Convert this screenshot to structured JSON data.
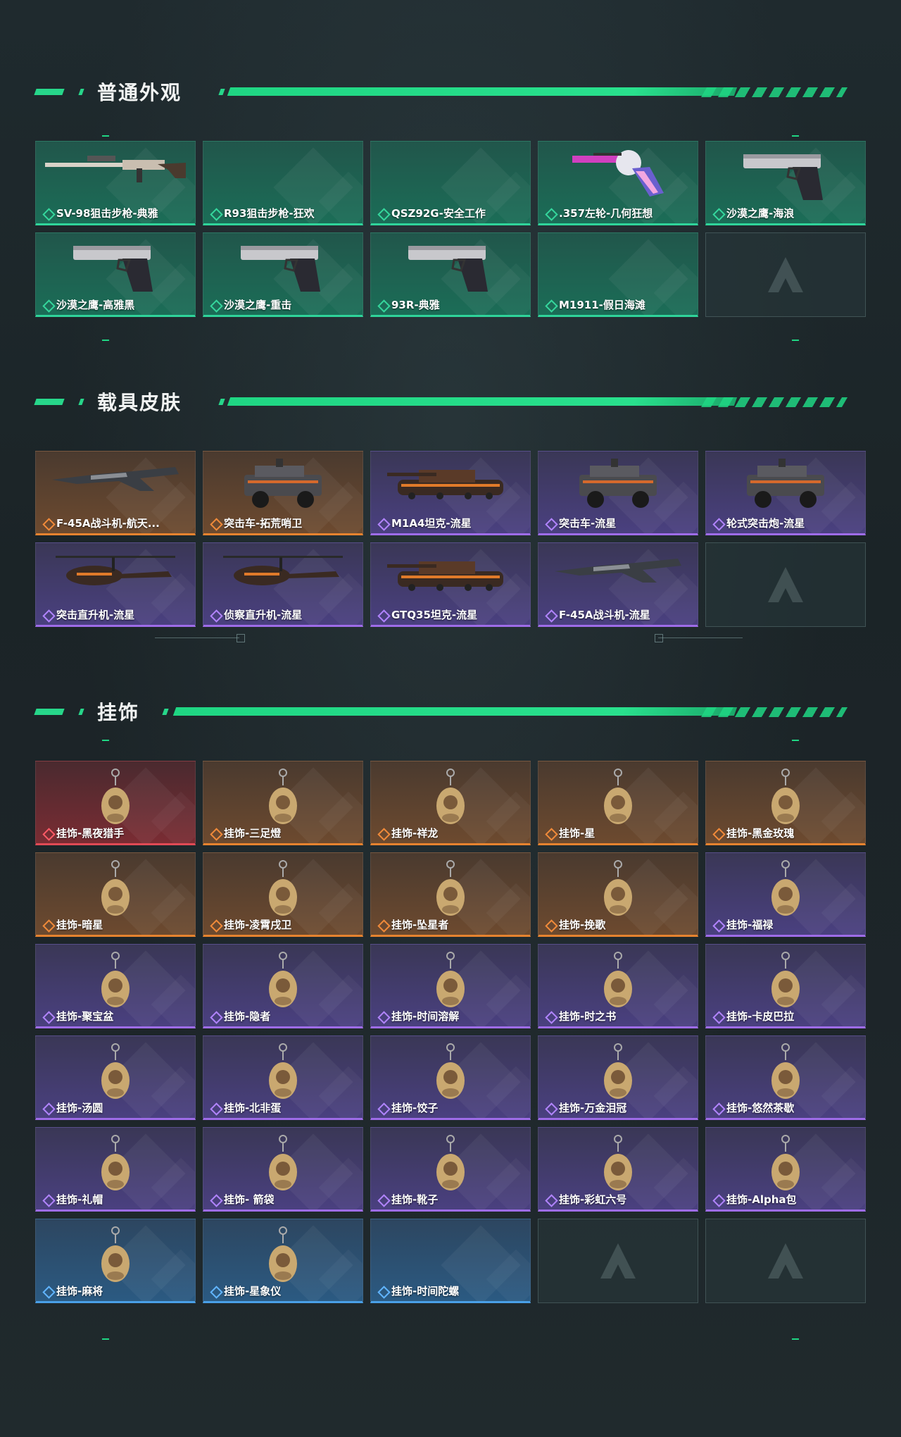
{
  "sections": [
    {
      "title": "普通外观",
      "items": [
        {
          "label": "SV-98狙击步枪-典雅",
          "rarity": "green",
          "icon": "sniper-rifle"
        },
        {
          "label": "R93狙击步枪-狂欢",
          "rarity": "green",
          "icon": "empty"
        },
        {
          "label": "QSZ92G-安全工作",
          "rarity": "green",
          "icon": "empty"
        },
        {
          "label": ".357左轮-几何狂想",
          "rarity": "green",
          "icon": "revolver"
        },
        {
          "label": "沙漠之鹰-海浪",
          "rarity": "green",
          "icon": "pistol"
        },
        {
          "label": "沙漠之鹰-高雅黑",
          "rarity": "green",
          "icon": "pistol"
        },
        {
          "label": "沙漠之鹰-重击",
          "rarity": "green",
          "icon": "pistol"
        },
        {
          "label": "93R-典雅",
          "rarity": "green",
          "icon": "pistol"
        },
        {
          "label": "M1911-假日海滩",
          "rarity": "green",
          "icon": "empty"
        }
      ]
    },
    {
      "title": "载具皮肤",
      "items": [
        {
          "label": "F-45A战斗机-航天...",
          "rarity": "orange",
          "icon": "jet"
        },
        {
          "label": "突击车-拓荒哨卫",
          "rarity": "orange",
          "icon": "armored-car"
        },
        {
          "label": "M1A4坦克-流星",
          "rarity": "purple",
          "icon": "tank"
        },
        {
          "label": "突击车-流星",
          "rarity": "purple",
          "icon": "armored-car"
        },
        {
          "label": "轮式突击炮-流星",
          "rarity": "purple",
          "icon": "armored-car"
        },
        {
          "label": "突击直升机-流星",
          "rarity": "purple",
          "icon": "helicopter"
        },
        {
          "label": "侦察直升机-流星",
          "rarity": "purple",
          "icon": "helicopter"
        },
        {
          "label": "GTQ35坦克-流星",
          "rarity": "purple",
          "icon": "tank"
        },
        {
          "label": "F-45A战斗机-流星",
          "rarity": "purple",
          "icon": "jet"
        }
      ]
    },
    {
      "title": "挂饰",
      "items": [
        {
          "label": "挂饰-黑夜猎手",
          "rarity": "red",
          "icon": "charm"
        },
        {
          "label": "挂饰-三足燈",
          "rarity": "orange",
          "icon": "charm"
        },
        {
          "label": "挂饰-祥龙",
          "rarity": "orange",
          "icon": "charm"
        },
        {
          "label": "挂饰-星",
          "rarity": "orange",
          "icon": "charm"
        },
        {
          "label": "挂饰-黑金玫瑰",
          "rarity": "orange",
          "icon": "charm"
        },
        {
          "label": "挂饰-暗星",
          "rarity": "orange",
          "icon": "charm"
        },
        {
          "label": "挂饰-凌霄戌卫",
          "rarity": "orange",
          "icon": "charm"
        },
        {
          "label": "挂饰-坠星者",
          "rarity": "orange",
          "icon": "charm"
        },
        {
          "label": "挂饰-挽歌",
          "rarity": "orange",
          "icon": "charm"
        },
        {
          "label": "挂饰-福禄",
          "rarity": "purple",
          "icon": "charm"
        },
        {
          "label": "挂饰-聚宝盆",
          "rarity": "purple",
          "icon": "charm"
        },
        {
          "label": "挂饰-隐者",
          "rarity": "purple",
          "icon": "charm"
        },
        {
          "label": "挂饰-时间溶解",
          "rarity": "purple",
          "icon": "charm"
        },
        {
          "label": "挂饰-时之书",
          "rarity": "purple",
          "icon": "charm"
        },
        {
          "label": "挂饰-卡皮巴拉",
          "rarity": "purple",
          "icon": "charm"
        },
        {
          "label": "挂饰-汤圆",
          "rarity": "purple",
          "icon": "charm"
        },
        {
          "label": "挂饰-北非蛋",
          "rarity": "purple",
          "icon": "charm"
        },
        {
          "label": "挂饰-饺子",
          "rarity": "purple",
          "icon": "charm"
        },
        {
          "label": "挂饰-万金泪冠",
          "rarity": "purple",
          "icon": "charm"
        },
        {
          "label": "挂饰-悠然茶歇",
          "rarity": "purple",
          "icon": "charm"
        },
        {
          "label": "挂饰-礼帽",
          "rarity": "purple",
          "icon": "charm"
        },
        {
          "label": "挂饰- 箭袋",
          "rarity": "purple",
          "icon": "charm"
        },
        {
          "label": "挂饰-靴子",
          "rarity": "purple",
          "icon": "charm"
        },
        {
          "label": "挂饰-彩虹六号",
          "rarity": "purple",
          "icon": "charm"
        },
        {
          "label": "挂饰-Alpha包",
          "rarity": "purple",
          "icon": "charm"
        },
        {
          "label": "挂饰-麻将",
          "rarity": "blue",
          "icon": "charm"
        },
        {
          "label": "挂饰-星象仪",
          "rarity": "blue",
          "icon": "charm"
        },
        {
          "label": "挂饰-时间陀螺",
          "rarity": "blue",
          "icon": "empty"
        }
      ]
    }
  ],
  "colors": {
    "accent": "#1fd683",
    "green": "#2fd49a",
    "orange": "#e6832f",
    "purple": "#9e6ce8",
    "red": "#e04a55",
    "blue": "#4aa0e8"
  }
}
